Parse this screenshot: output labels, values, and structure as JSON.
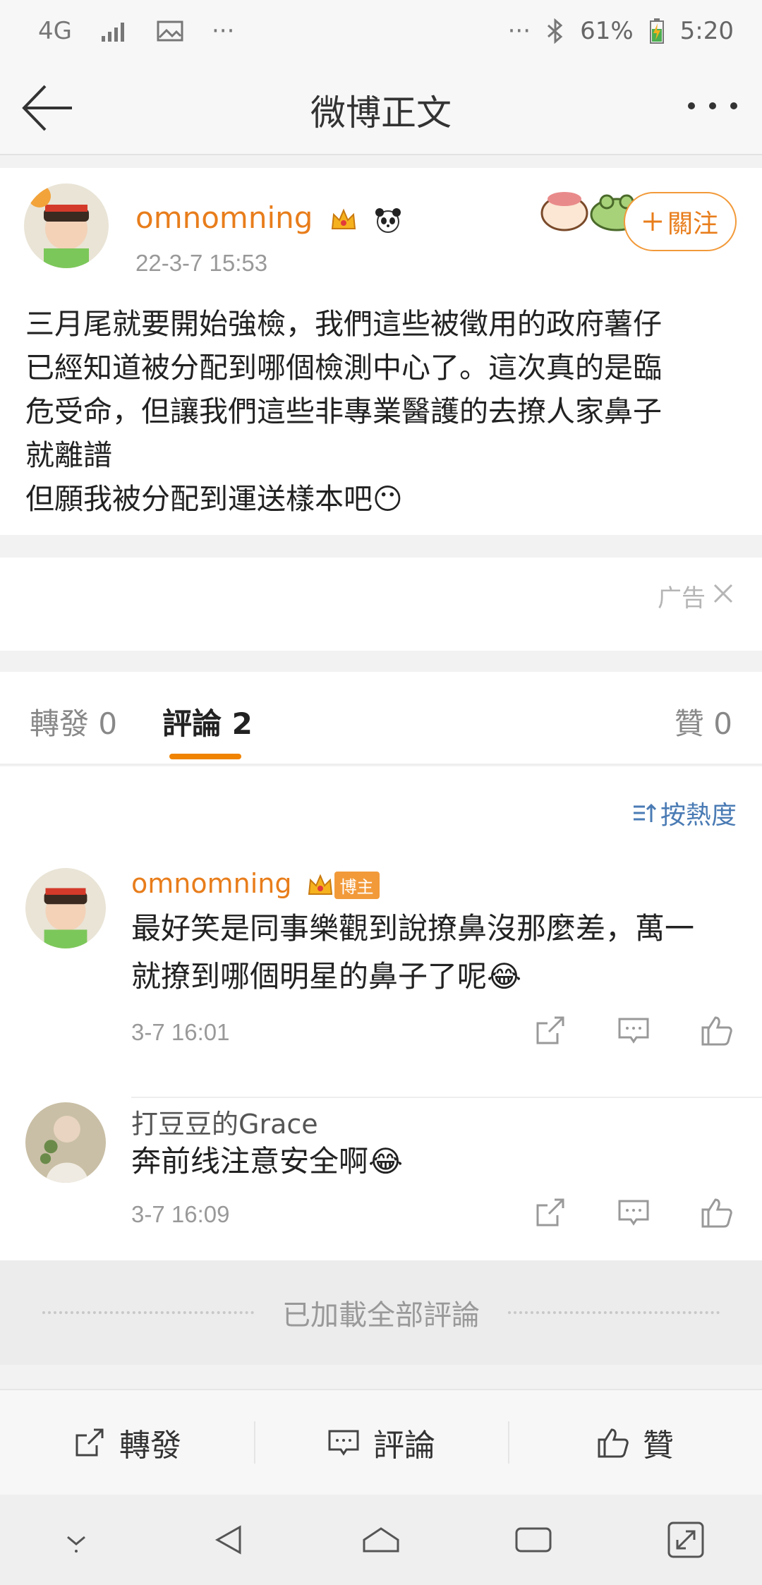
{
  "status_bar": {
    "network": "4G",
    "ellipsis_left": "···",
    "ellipsis_right": "···",
    "battery": "61%",
    "time": "5:20"
  },
  "nav": {
    "title": "微博正文"
  },
  "post": {
    "username": "omnomning",
    "time": "22-3-7 15:53",
    "follow_label": "關注",
    "body_lines": [
      "三月尾就要開始強檢，我們這些被徵用的政府薯仔",
      "已經知道被分配到哪個檢測中心了。這次真的是臨",
      "危受命，但讓我們這些非專業醫護的去撩人家鼻子",
      "就離譜",
      "但願我被分配到運送樣本吧😶"
    ]
  },
  "ad": {
    "label": "广告"
  },
  "tabs": {
    "repost": "轉發 0",
    "comments": "評論 2",
    "likes": "贊 0"
  },
  "sort": {
    "label": "按熱度"
  },
  "comments": [
    {
      "username": "omnomning",
      "badge": "博主",
      "text_lines": [
        "最好笑是同事樂觀到說撩鼻沒那麼差，萬一",
        "就撩到哪個明星的鼻子了呢😂"
      ],
      "time": "3-7 16:01"
    },
    {
      "username": "打豆豆的Grace",
      "text_lines": [
        "奔前线注意安全啊😂"
      ],
      "time": "3-7 16:09"
    }
  ],
  "footer_note": "已加載全部評論",
  "bottom_bar": {
    "repost": "轉發",
    "comment": "評論",
    "like": "贊"
  },
  "colors": {
    "accent": "#e87d1b",
    "tab_indicator": "#f08300",
    "link": "#4a7bb4"
  }
}
